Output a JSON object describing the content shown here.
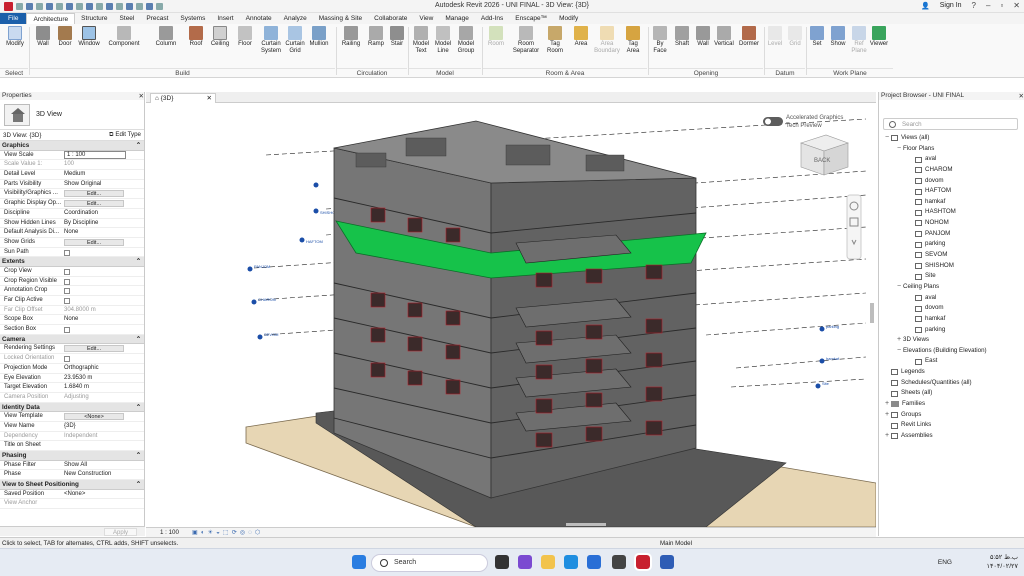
{
  "window": {
    "title": "Autodesk Revit 2026 - UNI FINAL - 3D View: {3D}",
    "user": "Sign In"
  },
  "ribbon": {
    "tabs": [
      "File",
      "Architecture",
      "Structure",
      "Steel",
      "Precast",
      "Systems",
      "Insert",
      "Annotate",
      "Analyze",
      "Massing & Site",
      "Collaborate",
      "View",
      "Manage",
      "Add-Ins",
      "Enscape™",
      "Modify"
    ],
    "active_tab": "Architecture",
    "buttons": {
      "modify": "Modify",
      "wall": "Wall",
      "door": "Door",
      "window": "Window",
      "component": "Component",
      "column": "Column",
      "roof": "Roof",
      "ceiling": "Ceiling",
      "floor": "Floor",
      "curtain_system": "Curtain System",
      "curtain_grid": "Curtain Grid",
      "mullion": "Mullion",
      "railing": "Railing",
      "ramp": "Ramp",
      "stair": "Stair",
      "model_text": "Model Text",
      "model_line": "Model Line",
      "model_group": "Model Group",
      "room": "Room",
      "room_separator": "Room Separator",
      "tag_room": "Tag Room",
      "area": "Area",
      "area_boundary": "Area Boundary",
      "tag_area": "Tag Area",
      "by_face": "By Face",
      "shaft": "Shaft",
      "opening_wall": "Wall",
      "vertical": "Vertical",
      "dormer": "Dormer",
      "level": "Level",
      "grid": "Grid",
      "set": "Set",
      "show": "Show",
      "ref_plane": "Ref Plane",
      "viewer": "Viewer"
    },
    "groups": {
      "select": "Select",
      "build": "Build",
      "circulation": "Circulation",
      "model": "Model",
      "room_area": "Room & Area",
      "opening": "Opening",
      "datum": "Datum",
      "work_plane": "Work Plane"
    }
  },
  "properties": {
    "header": "Properties",
    "type_name": "3D View",
    "instance_label": "3D View: {3D}",
    "edit_type": "Edit Type",
    "apply": "Apply",
    "sections": [
      {
        "title": "Graphics",
        "rows": [
          {
            "k": "View Scale",
            "v": "1 : 100",
            "kind": "input"
          },
          {
            "k": "Scale Value    1:",
            "v": "100",
            "kind": "dim"
          },
          {
            "k": "Detail Level",
            "v": "Medium"
          },
          {
            "k": "Parts Visibility",
            "v": "Show Original"
          },
          {
            "k": "Visibility/Graphics ...",
            "v": "Edit...",
            "kind": "button"
          },
          {
            "k": "Graphic Display Op...",
            "v": "Edit...",
            "kind": "button"
          },
          {
            "k": "Discipline",
            "v": "Coordination"
          },
          {
            "k": "Show Hidden Lines",
            "v": "By Discipline"
          },
          {
            "k": "Default Analysis Di...",
            "v": "None"
          },
          {
            "k": "Show Grids",
            "v": "Edit...",
            "kind": "button"
          },
          {
            "k": "Sun Path",
            "v": "",
            "kind": "check"
          }
        ]
      },
      {
        "title": "Extents",
        "rows": [
          {
            "k": "Crop View",
            "v": "",
            "kind": "check"
          },
          {
            "k": "Crop Region Visible",
            "v": "",
            "kind": "check"
          },
          {
            "k": "Annotation Crop",
            "v": "",
            "kind": "check"
          },
          {
            "k": "Far Clip Active",
            "v": "",
            "kind": "check"
          },
          {
            "k": "Far Clip Offset",
            "v": "304.8000 m",
            "kind": "dim"
          },
          {
            "k": "Scope Box",
            "v": "None"
          },
          {
            "k": "Section Box",
            "v": "",
            "kind": "check"
          }
        ]
      },
      {
        "title": "Camera",
        "rows": [
          {
            "k": "Rendering Settings",
            "v": "Edit...",
            "kind": "button"
          },
          {
            "k": "Locked Orientation",
            "v": "",
            "kind": "dimcheck"
          },
          {
            "k": "Projection Mode",
            "v": "Orthographic"
          },
          {
            "k": "Eye Elevation",
            "v": "23.9530 m"
          },
          {
            "k": "Target Elevation",
            "v": "1.6840 m"
          },
          {
            "k": "Camera Position",
            "v": "Adjusting",
            "kind": "dim"
          }
        ]
      },
      {
        "title": "Identity Data",
        "rows": [
          {
            "k": "View Template",
            "v": "<None>",
            "kind": "button"
          },
          {
            "k": "View Name",
            "v": "{3D}"
          },
          {
            "k": "Dependency",
            "v": "Independent",
            "kind": "dim"
          },
          {
            "k": "Title on Sheet",
            "v": ""
          }
        ]
      },
      {
        "title": "Phasing",
        "rows": [
          {
            "k": "Phase Filter",
            "v": "Show All"
          },
          {
            "k": "Phase",
            "v": "New Construction"
          }
        ]
      },
      {
        "title": "View to Sheet Positioning",
        "rows": [
          {
            "k": "Saved Position",
            "v": "<None>"
          },
          {
            "k": "View Anchor",
            "v": "",
            "kind": "dim"
          }
        ]
      }
    ]
  },
  "view": {
    "tab_label": "{3D}",
    "accelerated": "Accelerated Graphics",
    "tech_preview": "Tech Preview",
    "viewcube_face": "BACK",
    "scale": "1 : 100",
    "level_tags_left": [
      "SHISHOM",
      "HAFTOM",
      "PANJOM",
      "CHAROM",
      "SEVOM"
    ],
    "level_tags_right": [
      "parking",
      "hamkaf",
      "Site"
    ]
  },
  "browser": {
    "header": "Project Browser - UNI FINAL",
    "search_placeholder": "Search",
    "items": [
      {
        "t": "Views (all)",
        "lvl": 0,
        "tg": "−",
        "ic": "vi"
      },
      {
        "t": "Floor Plans",
        "lvl": 1,
        "tg": "−",
        "ic": ""
      },
      {
        "t": "aval",
        "lvl": 2,
        "ic": "vi"
      },
      {
        "t": "CHAROM",
        "lvl": 2,
        "ic": "vi"
      },
      {
        "t": "dovom",
        "lvl": 2,
        "ic": "vi"
      },
      {
        "t": "HAFTOM",
        "lvl": 2,
        "ic": "vi"
      },
      {
        "t": "hamkaf",
        "lvl": 2,
        "ic": "vi"
      },
      {
        "t": "HASHTOM",
        "lvl": 2,
        "ic": "vi"
      },
      {
        "t": "NOHOM",
        "lvl": 2,
        "ic": "vi"
      },
      {
        "t": "PANJOM",
        "lvl": 2,
        "ic": "vi"
      },
      {
        "t": "parking",
        "lvl": 2,
        "ic": "vi"
      },
      {
        "t": "SEVOM",
        "lvl": 2,
        "ic": "vi"
      },
      {
        "t": "SHISHOM",
        "lvl": 2,
        "ic": "vi"
      },
      {
        "t": "Site",
        "lvl": 2,
        "ic": "vi"
      },
      {
        "t": "Ceiling Plans",
        "lvl": 1,
        "tg": "−",
        "ic": ""
      },
      {
        "t": "aval",
        "lvl": 2,
        "ic": "vi"
      },
      {
        "t": "dovom",
        "lvl": 2,
        "ic": "vi"
      },
      {
        "t": "hamkaf",
        "lvl": 2,
        "ic": "vi"
      },
      {
        "t": "parking",
        "lvl": 2,
        "ic": "vi"
      },
      {
        "t": "3D Views",
        "lvl": 1,
        "tg": "+",
        "ic": ""
      },
      {
        "t": "Elevations (Building Elevation)",
        "lvl": 1,
        "tg": "−",
        "ic": ""
      },
      {
        "t": "East",
        "lvl": 2,
        "ic": "vi"
      },
      {
        "t": "Legends",
        "lvl": 0,
        "tg": "",
        "ic": "vi"
      },
      {
        "t": "Schedules/Quantities (all)",
        "lvl": 0,
        "tg": "",
        "ic": "vi"
      },
      {
        "t": "Sheets (all)",
        "lvl": 0,
        "tg": "",
        "ic": "vi"
      },
      {
        "t": "Families",
        "lvl": 0,
        "tg": "+",
        "ic": "fi"
      },
      {
        "t": "Groups",
        "lvl": 0,
        "tg": "+",
        "ic": "vi"
      },
      {
        "t": "Revit Links",
        "lvl": 0,
        "tg": "",
        "ic": "vi"
      },
      {
        "t": "Assemblies",
        "lvl": 0,
        "tg": "+",
        "ic": "vi"
      }
    ]
  },
  "status": {
    "hint": "Click to select, TAB for alternates, CTRL adds, SHIFT unselects.",
    "model": "Main Model"
  },
  "taskbar": {
    "search": "Search",
    "lang": "ENG",
    "time": "۵:۵۲ ب.ظ",
    "date": "۱۴۰۴/۰۲/۲۷"
  },
  "colors": {
    "accent": "#1b5faa",
    "revit_red": "#c8202f",
    "floor_green": "#16c24a",
    "building_gray": "#6e6e6e",
    "ground_tan": "#e7d6b4"
  }
}
